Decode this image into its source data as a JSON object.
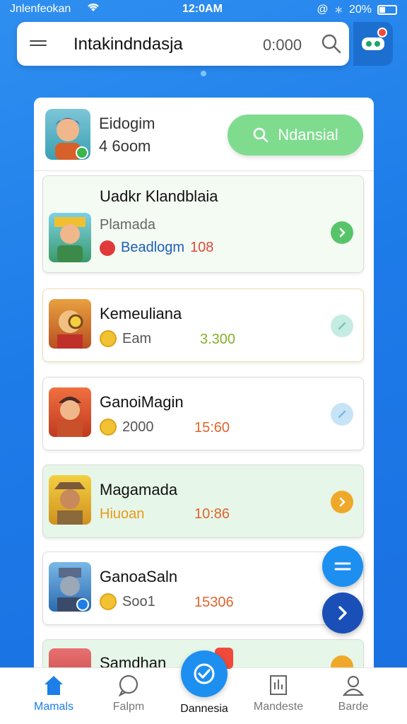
{
  "status_bar": {
    "carrier": "Jnlenfeokan",
    "time": "12:0AM",
    "battery": "20%"
  },
  "search": {
    "title": "Intakindndasja",
    "count": "0:000"
  },
  "profile": {
    "name": "Eidogim",
    "sub": "4 6oom",
    "button_label": "Ndansial"
  },
  "rows": [
    {
      "title": "Uadkr Klandblaia",
      "subtitle": "Plamada",
      "label": "Beadlogm",
      "value": "108",
      "value_color": "#e04a3a",
      "label_color": "#1d5fb8",
      "chevron_color": "#58c46a"
    },
    {
      "title": "Kemeuliana",
      "label": "Eam",
      "value": "3.300",
      "value_color": "#86b02a",
      "chevron_color": "#b9e8de"
    },
    {
      "title": "GanoiMagin",
      "label": "2000",
      "value": "15:60",
      "value_color": "#e0652e",
      "chevron_color": "#b8dcf2"
    },
    {
      "title": "Magamada",
      "label": "Hiuoan",
      "value": "10:86",
      "value_color": "#e0652e",
      "label_color": "#e59a1a",
      "chevron_color": "#f0a82a"
    },
    {
      "title": "GanoaSaln",
      "label": "Soo1",
      "value": "15306",
      "value_color": "#e0652e",
      "chevron_color": "#ffffff"
    },
    {
      "title": "Samdhan"
    }
  ],
  "nav": [
    {
      "label": "Mamals",
      "icon": "home-icon"
    },
    {
      "label": "Falpm",
      "icon": "chat-icon"
    },
    {
      "label": "Dannesia",
      "icon": "check-icon"
    },
    {
      "label": "Mandeste",
      "icon": "chart-icon"
    },
    {
      "label": "Barde",
      "icon": "profile-icon"
    }
  ],
  "colors": {
    "primary": "#1d7ee8",
    "accent_green": "#7fdc8f"
  }
}
